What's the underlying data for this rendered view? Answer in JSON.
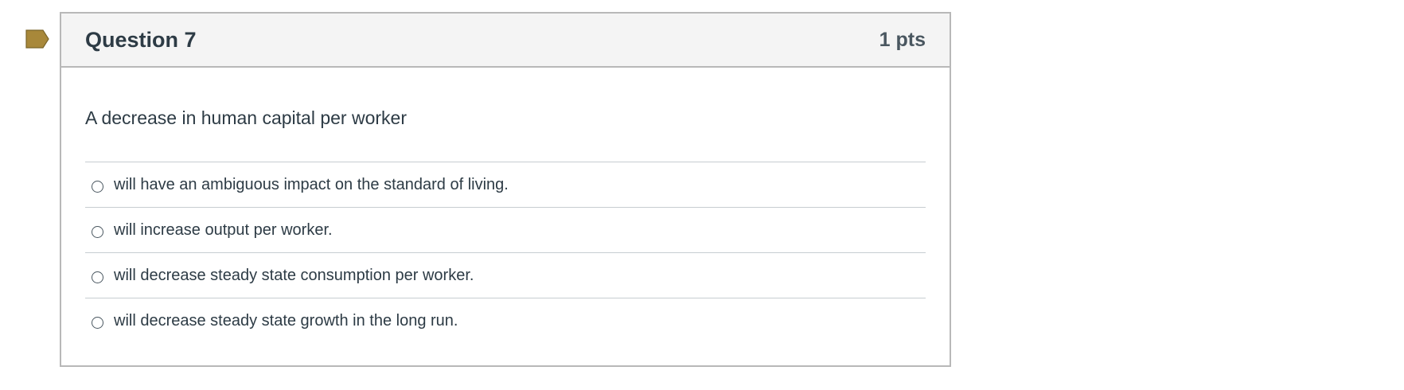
{
  "colors": {
    "flag": "#a8883a",
    "header_bg": "#f4f4f4",
    "border": "#b8b8b8",
    "text": "#2d3b45"
  },
  "question": {
    "title": "Question 7",
    "points": "1 pts",
    "text": "A decrease in human capital per worker",
    "answers": [
      {
        "label": "will have an ambiguous impact on the standard of living.",
        "selected": false
      },
      {
        "label": "will increase output per worker.",
        "selected": false
      },
      {
        "label": "will decrease steady state consumption per worker.",
        "selected": false
      },
      {
        "label": "will decrease steady state growth in the long run.",
        "selected": false
      }
    ]
  }
}
